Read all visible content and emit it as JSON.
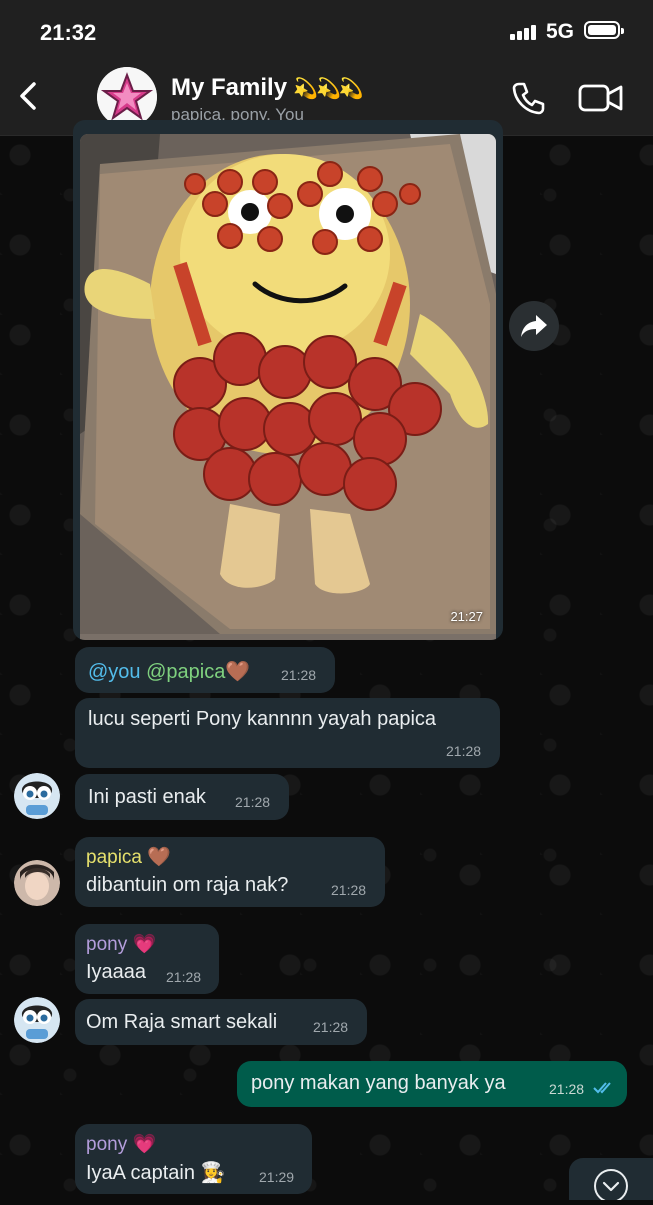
{
  "status_bar": {
    "time": "21:32",
    "network": "5G",
    "signal_bars": 4,
    "battery_level": 1.0
  },
  "header": {
    "title": "My Family",
    "title_emoji": "💫💫💫",
    "subtitle": "papica, pony, You",
    "avatar_icon": "pink-star-icon",
    "icons": {
      "back": "chevron-left-icon",
      "call": "phone-icon",
      "video": "video-camera-icon"
    }
  },
  "image_message": {
    "time": "21:27",
    "caption_alt": "forward-icon"
  },
  "messages": [
    {
      "id": "m1",
      "direction": "in",
      "sender": "",
      "text_parts": [
        "@you",
        " ",
        "@papica",
        "🤎"
      ],
      "time": "21:28"
    },
    {
      "id": "m2",
      "direction": "in",
      "sender": "",
      "text": "lucu seperti Pony kannnn yayah papica",
      "time": "21:28"
    },
    {
      "id": "m3",
      "direction": "in",
      "sender": "",
      "text": "Ini pasti enak",
      "time": "21:28",
      "avatar": "powerpuff-avatar"
    },
    {
      "id": "m4",
      "direction": "in",
      "sender": "papica 🤎",
      "sender_color": "#e5e06c",
      "text": "dibantuin om raja nak?",
      "time": "21:28",
      "avatar": "papica-avatar"
    },
    {
      "id": "m5",
      "direction": "in",
      "sender": "pony 💗",
      "sender_color": "#b39ddb",
      "text": "Iyaaaa",
      "time": "21:28"
    },
    {
      "id": "m6",
      "direction": "in",
      "sender": "",
      "text": "Om Raja smart sekali",
      "time": "21:28",
      "avatar": "powerpuff-avatar"
    },
    {
      "id": "m7",
      "direction": "out",
      "sender": "",
      "text": "pony makan yang banyak ya",
      "time": "21:28",
      "status": "read-ticks-icon"
    },
    {
      "id": "m8",
      "direction": "in",
      "sender": "pony 💗",
      "sender_color": "#b39ddb",
      "text": "IyaA captain 👩‍🍳",
      "time": "21:29"
    }
  ],
  "colors": {
    "incoming_bubble": "#202c33",
    "outgoing_bubble": "#005c4b",
    "read_tick": "#53bdeb"
  }
}
